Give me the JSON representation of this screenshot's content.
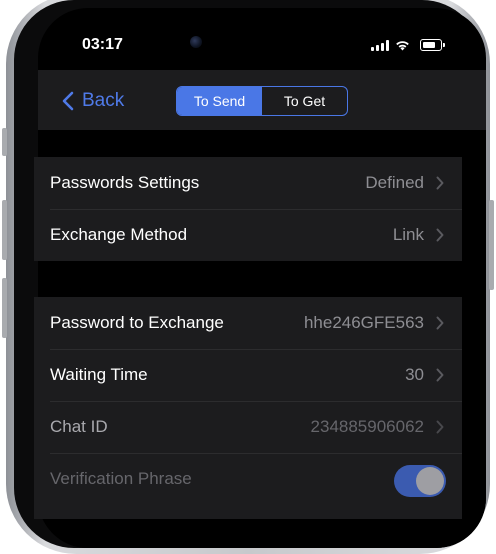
{
  "status_bar": {
    "time": "03:17"
  },
  "nav": {
    "back_label": "Back",
    "tabs": [
      {
        "label": "To Send",
        "active": true
      },
      {
        "label": "To Get",
        "active": false
      }
    ]
  },
  "settings": {
    "group1": [
      {
        "label": "Passwords Settings",
        "value": "Defined"
      },
      {
        "label": "Exchange Method",
        "value": "Link"
      }
    ],
    "group2": [
      {
        "label": "Password to Exchange",
        "value": "hhe246GFE563"
      },
      {
        "label": "Waiting Time",
        "value": "30"
      },
      {
        "label": "Chat ID",
        "value": "234885906062"
      },
      {
        "label": "Verification Phrase",
        "toggle_on": true
      }
    ]
  },
  "colors": {
    "accent": "#4a77e6",
    "background": "#000000",
    "cell": "#1c1c1e",
    "secondary_text": "#8e8e93"
  }
}
